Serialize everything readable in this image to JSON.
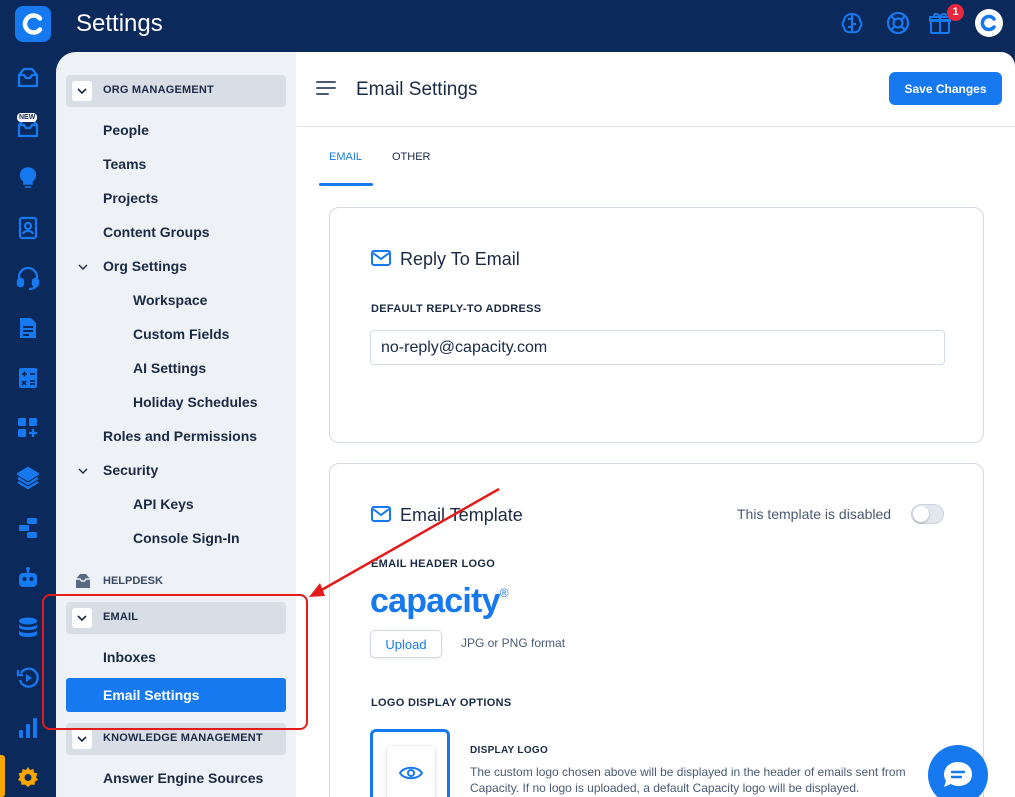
{
  "app": {
    "title": "Settings",
    "notification_count": "1"
  },
  "rail": {
    "new_badge": "NEW"
  },
  "nav": {
    "sections": {
      "org_management": "ORG MANAGEMENT",
      "helpdesk": "HELPDESK",
      "email": "EMAIL",
      "knowledge_management": "KNOWLEDGE MANAGEMENT"
    },
    "items": {
      "people": "People",
      "teams": "Teams",
      "projects": "Projects",
      "content_groups": "Content Groups",
      "org_settings": "Org Settings",
      "workspace": "Workspace",
      "custom_fields": "Custom Fields",
      "ai_settings": "AI Settings",
      "holiday_schedules": "Holiday Schedules",
      "roles_permissions": "Roles and Permissions",
      "security": "Security",
      "api_keys": "API Keys",
      "console_signin": "Console Sign-In",
      "inboxes": "Inboxes",
      "email_settings": "Email Settings",
      "answer_engine_sources": "Answer Engine Sources"
    }
  },
  "main": {
    "title": "Email Settings",
    "save_label": "Save Changes",
    "tabs": [
      "EMAIL",
      "OTHER"
    ],
    "reply_card": {
      "title": "Reply To Email",
      "field_label": "DEFAULT REPLY-TO ADDRESS",
      "field_value": "no-reply@capacity.com"
    },
    "template_card": {
      "title": "Email Template",
      "toggle_label": "This template is disabled",
      "logo_label": "EMAIL HEADER LOGO",
      "brand_text": "capacity",
      "brand_mark": "®",
      "upload_label": "Upload",
      "upload_hint": "JPG or PNG format",
      "display_options_label": "LOGO DISPLAY OPTIONS",
      "option_title": "DISPLAY LOGO",
      "option_desc": "The custom logo chosen above will be displayed in the header of emails sent from Capacity. If no logo is uploaded, a default Capacity logo will be displayed."
    }
  },
  "colors": {
    "brand_navy": "#0b2a5b",
    "accent_blue": "#1779f0",
    "annotation_red": "#e31b1b",
    "notification_red": "#e5283d",
    "active_rail_orange": "#f7a700"
  }
}
